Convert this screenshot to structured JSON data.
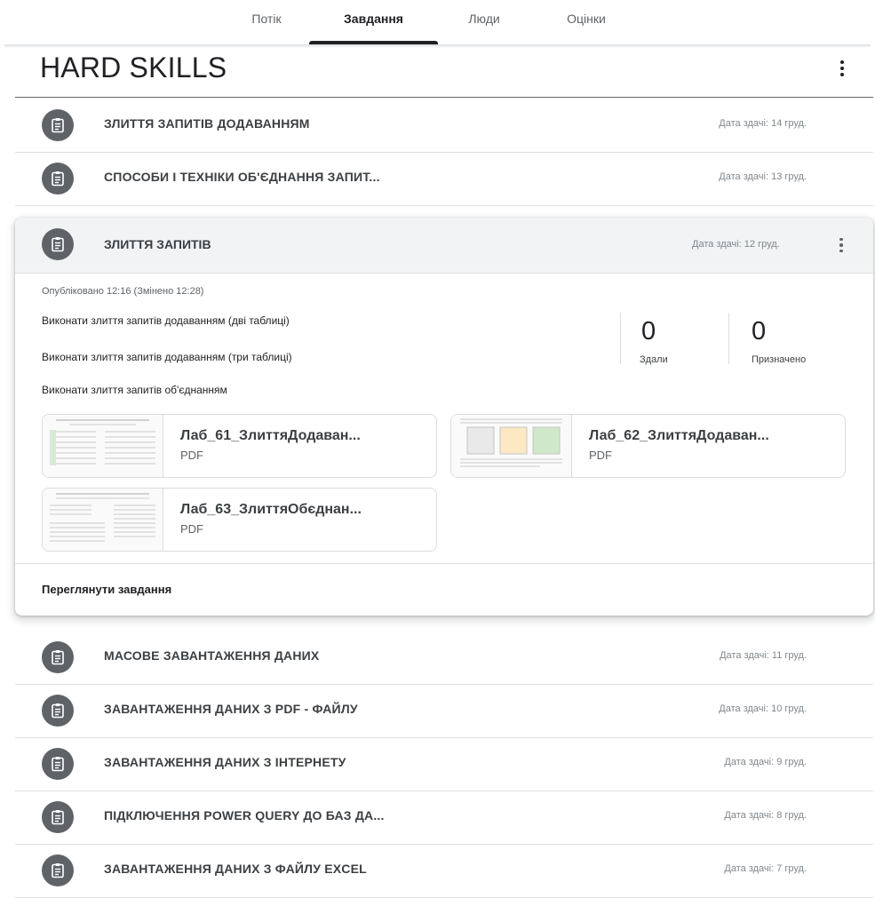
{
  "tabs": [
    "Потік",
    "Завдання",
    "Люди",
    "Оцінки"
  ],
  "topic": {
    "title": "HARD SKILLS"
  },
  "rows_top": [
    {
      "title": "ЗЛИТТЯ ЗАПИТІВ ДОДАВАННЯМ",
      "due": "Дата здачі: 14 груд."
    },
    {
      "title": "СПОСОБИ І ТЕХНІКИ ОБ'ЄДНАННЯ ЗАПИТ...",
      "due": "Дата здачі: 13 груд."
    }
  ],
  "expanded": {
    "title": "ЗЛИТТЯ ЗАПИТІВ",
    "due": "Дата здачі: 12 груд.",
    "posted": "Опубліковано 12:16 (Змінено 12:28)",
    "lines": [
      "Виконати злиття запитів додаванням (дві таблиці)",
      "Виконати злиття запитів додаванням (три таблиці)",
      "Виконати злиття запитів об'єднанням"
    ],
    "stats": [
      {
        "value": "0",
        "label": "Здали"
      },
      {
        "value": "0",
        "label": "Призначено"
      }
    ],
    "attachments": [
      {
        "name": "Лаб_61_ЗлиттяДодаван...",
        "type": "PDF"
      },
      {
        "name": "Лаб_62_ЗлиттяДодаван...",
        "type": "PDF"
      },
      {
        "name": "Лаб_63_ЗлиттяОбєднан...",
        "type": "PDF"
      }
    ],
    "view_label": "Переглянути завдання"
  },
  "rows_bottom": [
    {
      "title": "МАСОВЕ ЗАВАНТАЖЕННЯ ДАНИХ",
      "due": "Дата здачі: 11 груд."
    },
    {
      "title": "ЗАВАНТАЖЕННЯ ДАНИХ З PDF - ФАЙЛУ",
      "due": "Дата здачі: 10 груд."
    },
    {
      "title": "ЗАВАНТАЖЕННЯ ДАНИХ З ІНТЕРНЕТУ",
      "due": "Дата здачі: 9 груд."
    },
    {
      "title": "ПІДКЛЮЧЕННЯ POWER QUERY ДО БАЗ ДА...",
      "due": "Дата здачі: 8 груд."
    },
    {
      "title": "ЗАВАНТАЖЕННЯ ДАНИХ З ФАЙЛУ EXCEL",
      "due": "Дата здачі: 7 груд."
    }
  ],
  "icons": {
    "assignment": "assignment-icon",
    "more": "more-vert-icon"
  },
  "colors": {
    "icon_bg": "#5f6368",
    "active_tab": "#202124",
    "card_header_bg": "#f1f3f4"
  }
}
